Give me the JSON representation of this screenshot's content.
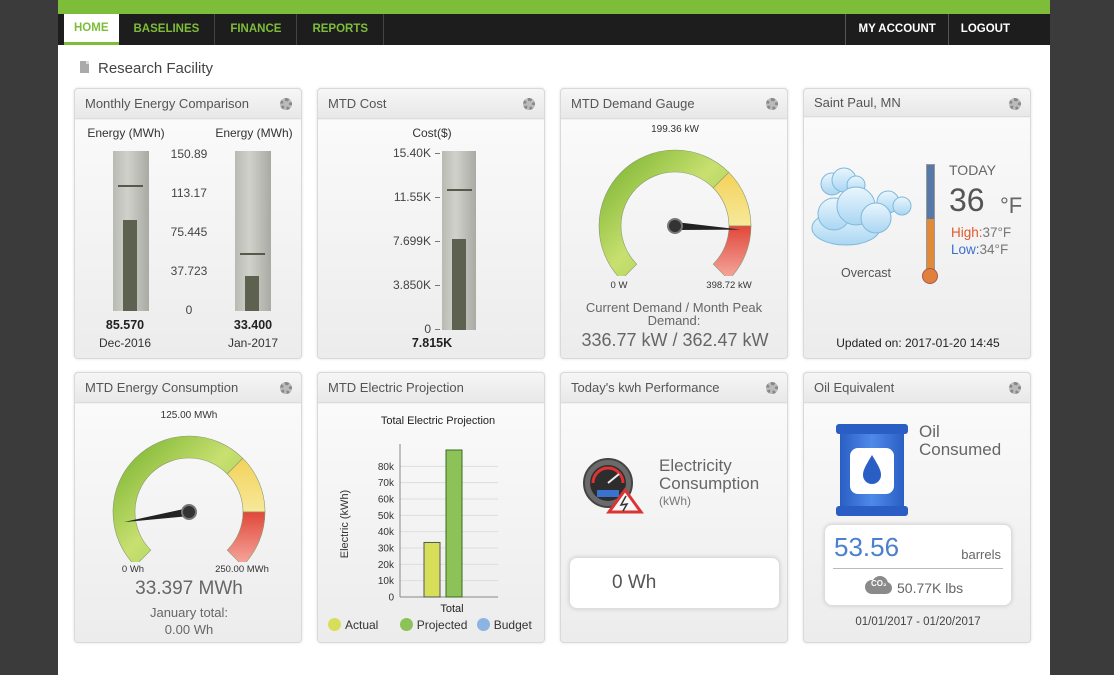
{
  "nav": {
    "items": [
      "HOME",
      "BASELINES",
      "FINANCE",
      "REPORTS"
    ],
    "right": [
      "MY ACCOUNT",
      "LOGOUT"
    ]
  },
  "page": {
    "title": "Research Facility"
  },
  "monthly": {
    "title": "Monthly Energy Comparison",
    "col1_label": "Energy (MWh)",
    "col2_label": "Energy (MWh)",
    "scale": [
      "150.89",
      "113.17",
      "75.445",
      "37.723",
      "0"
    ],
    "val1": "85.570",
    "date1": "Dec-2016",
    "val2": "33.400",
    "date2": "Jan-2017",
    "fill1": 0.567,
    "fill2": 0.221,
    "mark1": 0.79,
    "mark2": 0.36
  },
  "cost": {
    "title": "MTD Cost",
    "label": "Cost($)",
    "scale": [
      "15.40K",
      "11.55K",
      "7.699K",
      "3.850K",
      "0"
    ],
    "value": "7.815K",
    "fill": 0.507,
    "mark": 0.79
  },
  "demand": {
    "title": "MTD Demand Gauge",
    "top_label": "199.36 kW",
    "min_label": "0 W",
    "max_label": "398.72 kW",
    "caption": "Current Demand / Month Peak Demand:",
    "value": "336.77 kW / 362.47 kW",
    "fraction": 0.845
  },
  "weather": {
    "title": "Saint Paul, MN",
    "today": "TODAY",
    "temp": "36",
    "unit": "°F",
    "high_label": "High:",
    "high": "37°F",
    "low_label": "Low:",
    "low": "34°F",
    "condition": "Overcast",
    "updated": "Updated on: 2017-01-20 14:45"
  },
  "energy": {
    "title": "MTD Energy Consumption",
    "top_label": "125.00 MWh",
    "min_label": "0 Wh",
    "max_label": "250.00 MWh",
    "value": "33.397 MWh",
    "caption1": "January total:",
    "caption2": "0.00 Wh",
    "fraction": 0.134
  },
  "projection": {
    "title": "MTD Electric Projection",
    "legend": [
      "Actual",
      "Projected",
      "Budget"
    ],
    "legend_colors": [
      "#d7df5a",
      "#8cc257",
      "#8db3e2"
    ],
    "chart_data": {
      "type": "bar",
      "title": "Total Electric Projection",
      "ylabel": "Electric (kWh)",
      "categories": [
        "Total"
      ],
      "series": [
        {
          "name": "Actual",
          "values": [
            33400
          ]
        },
        {
          "name": "Projected",
          "values": [
            90000
          ]
        }
      ],
      "yticks": [
        "0",
        "10k",
        "20k",
        "30k",
        "40k",
        "50k",
        "60k",
        "70k",
        "80k"
      ],
      "ylim": [
        0,
        90000
      ]
    }
  },
  "kwh": {
    "title": "Today's kwh Performance",
    "line1": "Electricity",
    "line2": "Consumption",
    "unit": "(kWh)",
    "value": "0 Wh"
  },
  "oil": {
    "title": "Oil Equivalent",
    "line1": "Oil",
    "line2": "Consumed",
    "value": "53.56",
    "unit": "barrels",
    "co2": "CO₂",
    "co2_value": "50.77K lbs",
    "range": "01/01/2017 - 01/20/2017"
  }
}
